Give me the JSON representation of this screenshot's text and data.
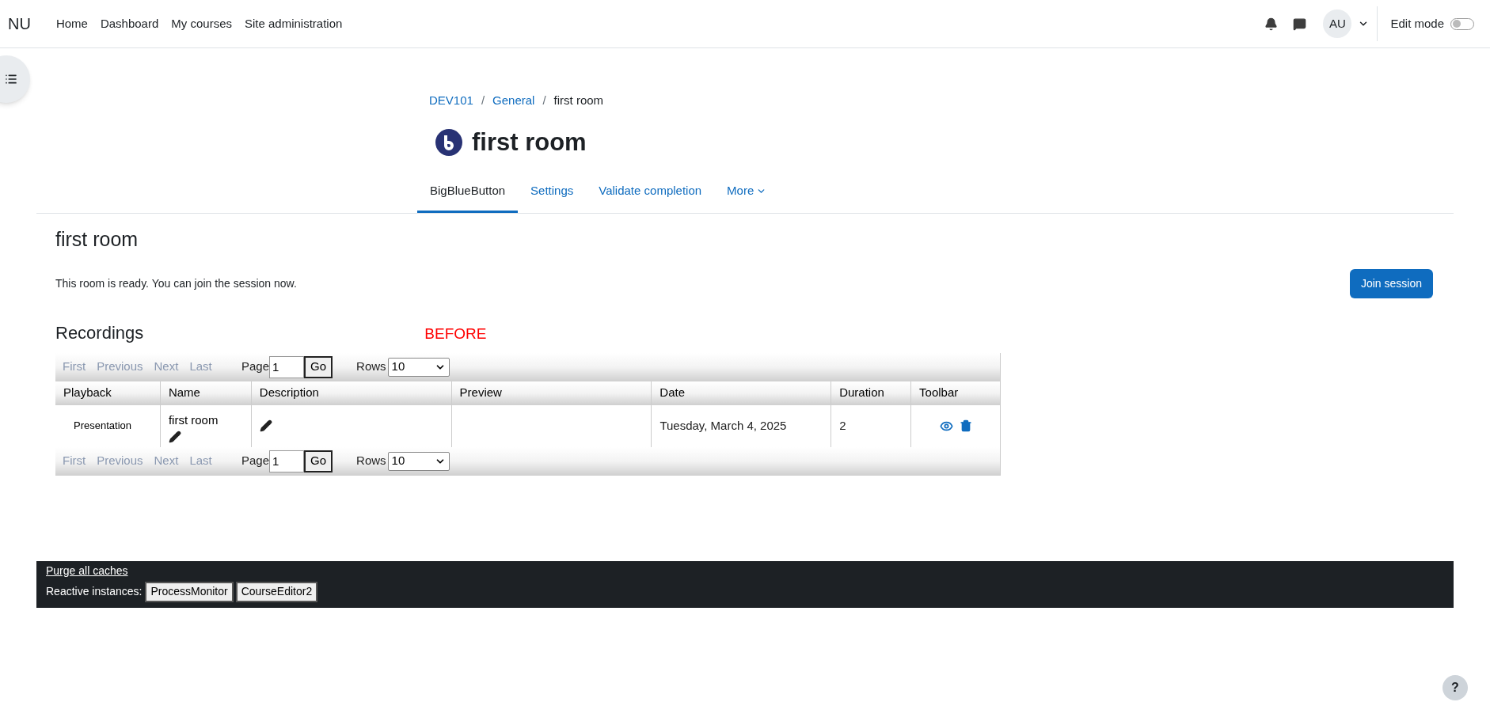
{
  "navbar": {
    "brand": "NU",
    "links": [
      "Home",
      "Dashboard",
      "My courses",
      "Site administration"
    ],
    "avatar": "AU",
    "edit_mode": {
      "label": "Edit mode",
      "on": false
    }
  },
  "breadcrumb": [
    {
      "label": "DEV101",
      "kind": "link"
    },
    {
      "label": "/",
      "kind": "separator"
    },
    {
      "label": "General",
      "kind": "link"
    },
    {
      "label": "/",
      "kind": "separator"
    },
    {
      "label": "first room",
      "kind": "current"
    }
  ],
  "page_title": "first room",
  "tabs": [
    {
      "label": "BigBlueButton",
      "selected": true,
      "dropdown": false
    },
    {
      "label": "Settings",
      "selected": false,
      "dropdown": false
    },
    {
      "label": "Validate completion",
      "selected": false,
      "dropdown": false
    },
    {
      "label": "More",
      "selected": false,
      "dropdown": true
    }
  ],
  "room": {
    "heading": "first room",
    "message": "This room is ready. You can join the session now.",
    "join_button": "Join session"
  },
  "recordings": {
    "heading": "Recordings",
    "annotation": "BEFORE",
    "pager_top": {
      "links": [
        {
          "label": "First",
          "disabled": true
        },
        {
          "label": "Previous",
          "disabled": true
        },
        {
          "label": "Next",
          "disabled": true
        },
        {
          "label": "Last",
          "disabled": true
        }
      ],
      "page_label": "Page",
      "page_value": "1",
      "go": "Go",
      "rows_label": "Rows",
      "rows_value": "10"
    },
    "columns": [
      "Playback",
      "Name",
      "Description",
      "Preview",
      "Date",
      "Duration",
      "Toolbar"
    ],
    "rows": [
      {
        "playback": "Presentation",
        "name": "first room",
        "date": "Tuesday, March 4, 2025",
        "duration": "2"
      }
    ],
    "pager_bottom": {
      "links": [
        {
          "label": "First",
          "disabled": true
        },
        {
          "label": "Previous",
          "disabled": true
        },
        {
          "label": "Next",
          "disabled": true
        },
        {
          "label": "Last",
          "disabled": true
        }
      ],
      "page_label": "Page",
      "page_value": "1",
      "go": "Go",
      "rows_label": "Rows",
      "rows_value": "10"
    }
  },
  "footer": {
    "purge_link": "Purge all caches",
    "reactive_label": "Reactive instances:",
    "instances": [
      "ProcessMonitor",
      "CourseEditor2"
    ]
  },
  "help_button": "?"
}
